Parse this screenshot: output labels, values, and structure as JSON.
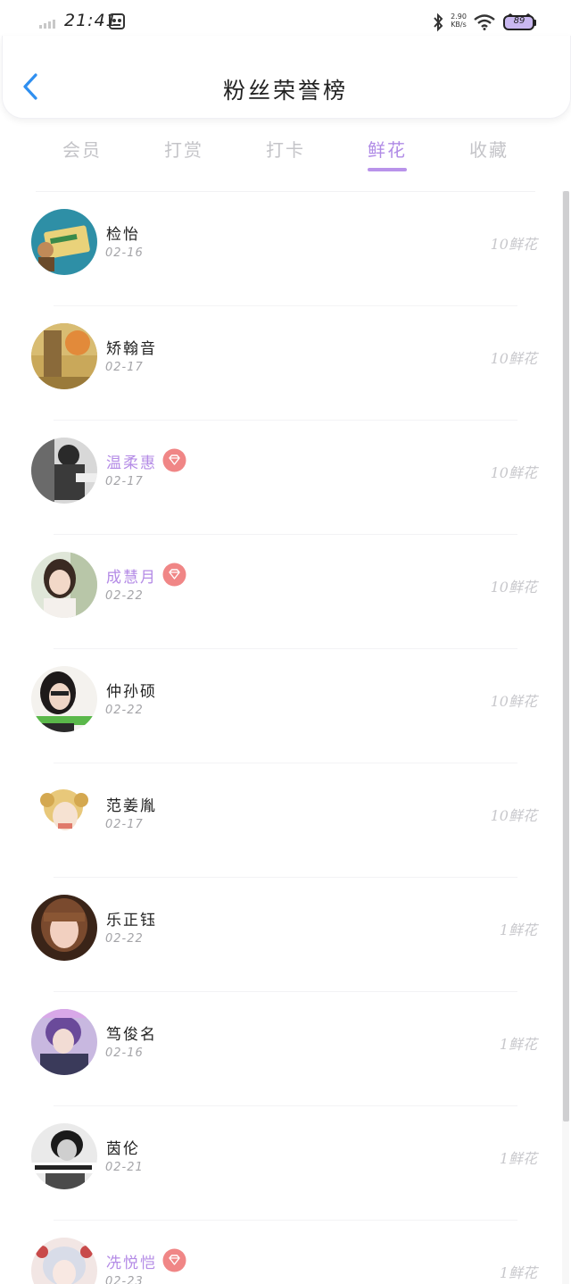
{
  "status_bar": {
    "time": "21:41",
    "net_speed_top": "2.90",
    "net_speed_bottom": "KB/s",
    "battery": "89"
  },
  "header": {
    "title": "粉丝荣誉榜"
  },
  "tabs": [
    {
      "label": "会员"
    },
    {
      "label": "打赏"
    },
    {
      "label": "打卡"
    },
    {
      "label": "鲜花"
    },
    {
      "label": "收藏"
    }
  ],
  "active_tab": "鲜花",
  "fans": [
    {
      "name": "检怡",
      "date": "02-16",
      "amount": "10鲜花",
      "vip": false
    },
    {
      "name": "矫翰音",
      "date": "02-17",
      "amount": "10鲜花",
      "vip": false
    },
    {
      "name": "温柔惠",
      "date": "02-17",
      "amount": "10鲜花",
      "vip": true
    },
    {
      "name": "成慧月",
      "date": "02-22",
      "amount": "10鲜花",
      "vip": true
    },
    {
      "name": "仲孙硕",
      "date": "02-22",
      "amount": "10鲜花",
      "vip": false
    },
    {
      "name": "范姜胤",
      "date": "02-17",
      "amount": "10鲜花",
      "vip": false
    },
    {
      "name": "乐正钰",
      "date": "02-22",
      "amount": "1鲜花",
      "vip": false
    },
    {
      "name": "笃俊名",
      "date": "02-16",
      "amount": "1鲜花",
      "vip": false
    },
    {
      "name": "茵伦",
      "date": "02-21",
      "amount": "1鲜花",
      "vip": false
    },
    {
      "name": "冼悦恺",
      "date": "02-23",
      "amount": "1鲜花",
      "vip": true
    }
  ],
  "colors": {
    "accent": "#b48be6",
    "vip_badge": "#f08686",
    "back_arrow": "#2f8ff0"
  }
}
